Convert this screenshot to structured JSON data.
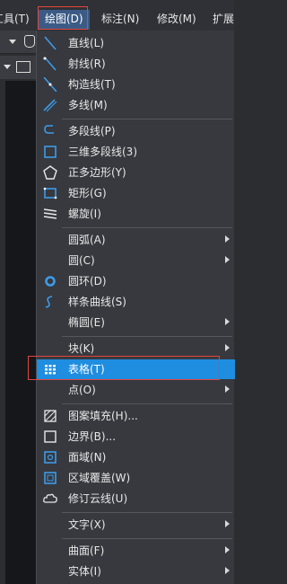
{
  "menubar": {
    "items": [
      "工具(T)",
      "绘图(D)",
      "标注(N)",
      "修改(M)",
      "扩展"
    ]
  },
  "menu": {
    "items": [
      {
        "label": "直线(L)",
        "icon": "line-icon",
        "submenu": false
      },
      {
        "label": "射线(R)",
        "icon": "ray-icon",
        "submenu": false
      },
      {
        "label": "构造线(T)",
        "icon": "construction-line-icon",
        "submenu": false
      },
      {
        "label": "多线(M)",
        "icon": "multiline-icon",
        "submenu": false
      },
      {
        "label": "多段线(P)",
        "icon": "polyline-icon",
        "submenu": false
      },
      {
        "label": "三维多段线(3)",
        "icon": "3d-polyline-icon",
        "submenu": false
      },
      {
        "label": "正多边形(Y)",
        "icon": "polygon-icon",
        "submenu": false
      },
      {
        "label": "矩形(G)",
        "icon": "rectangle-icon",
        "submenu": false
      },
      {
        "label": "螺旋(I)",
        "icon": "helix-icon",
        "submenu": false
      },
      {
        "label": "圆弧(A)",
        "icon": "",
        "submenu": true
      },
      {
        "label": "圆(C)",
        "icon": "",
        "submenu": true
      },
      {
        "label": "圆环(D)",
        "icon": "donut-icon",
        "submenu": false
      },
      {
        "label": "样条曲线(S)",
        "icon": "spline-icon",
        "submenu": false
      },
      {
        "label": "椭圆(E)",
        "icon": "",
        "submenu": true
      },
      {
        "label": "块(K)",
        "icon": "",
        "submenu": true
      },
      {
        "label": "表格(T)",
        "icon": "table-icon",
        "submenu": false,
        "highlighted": true
      },
      {
        "label": "点(O)",
        "icon": "",
        "submenu": true
      },
      {
        "label": "图案填充(H)...",
        "icon": "hatch-icon",
        "submenu": false
      },
      {
        "label": "边界(B)...",
        "icon": "boundary-icon",
        "submenu": false
      },
      {
        "label": "面域(N)",
        "icon": "region-icon",
        "submenu": false
      },
      {
        "label": "区域覆盖(W)",
        "icon": "wipeout-icon",
        "submenu": false
      },
      {
        "label": "修订云线(U)",
        "icon": "revcloud-icon",
        "submenu": false
      },
      {
        "label": "文字(X)",
        "icon": "",
        "submenu": true
      },
      {
        "label": "曲面(F)",
        "icon": "",
        "submenu": true
      },
      {
        "label": "实体(I)",
        "icon": "",
        "submenu": true
      }
    ]
  },
  "colors": {
    "menu_bg": "#37393e",
    "highlight": "#1f8de0",
    "annotation_red": "#e0463c",
    "icon_blue": "#3d9be9"
  }
}
